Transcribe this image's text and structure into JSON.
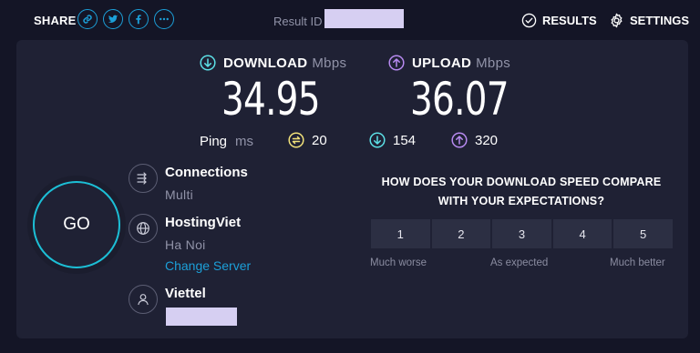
{
  "header": {
    "share_label": "SHARE",
    "share_buttons": [
      "link-icon",
      "twitter-icon",
      "facebook-icon",
      "more-icon"
    ],
    "result_label": "Result ID",
    "results_label": "RESULTS",
    "settings_label": "SETTINGS"
  },
  "download": {
    "label": "DOWNLOAD",
    "unit": "Mbps",
    "value": "34.95",
    "color": "#5ce0e6"
  },
  "upload": {
    "label": "UPLOAD",
    "unit": "Mbps",
    "value": "36.07",
    "color": "#b78af0"
  },
  "ping": {
    "label": "Ping",
    "unit": "ms",
    "idle": "20",
    "download": "154",
    "upload": "320",
    "idle_color": "#f2e27a"
  },
  "go_label": "GO",
  "connections": {
    "title": "Connections",
    "value": "Multi"
  },
  "server": {
    "title": "HostingViet",
    "location": "Ha Noi",
    "change_label": "Change Server"
  },
  "isp": {
    "title": "Viettel"
  },
  "survey": {
    "question": "HOW DOES YOUR DOWNLOAD SPEED COMPARE WITH YOUR EXPECTATIONS?",
    "options": [
      "1",
      "2",
      "3",
      "4",
      "5"
    ],
    "low_label": "Much worse",
    "mid_label": "As expected",
    "high_label": "Much better"
  },
  "colors": {
    "accent": "#1c9fd8",
    "background": "#141526",
    "panel": "#1f2134"
  }
}
